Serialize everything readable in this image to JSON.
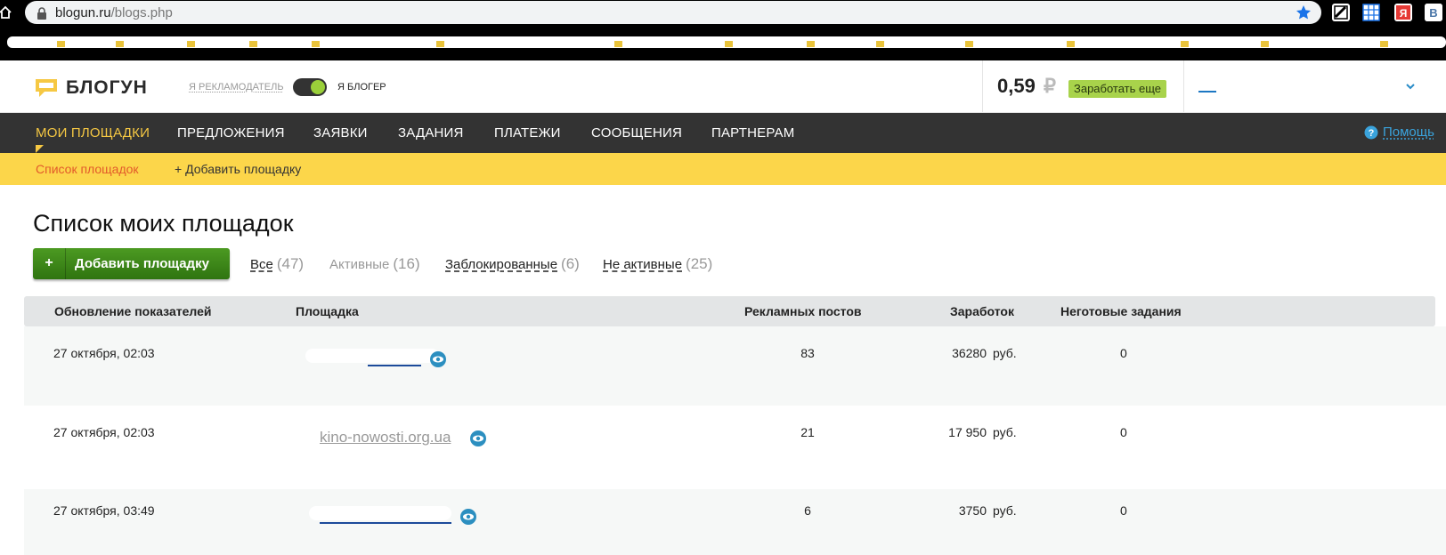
{
  "browser": {
    "url_host": "blogun.ru",
    "url_path": "/blogs.php",
    "extensions": [
      {
        "icon": "extension-icon",
        "color": "#ffffff"
      },
      {
        "icon": "grid-icon",
        "color": "#1a73e8"
      },
      {
        "icon": "yandex-icon",
        "color": "#e53935"
      },
      {
        "icon": "vk-icon",
        "color": "#4a76a8"
      }
    ],
    "vk_letter": "В"
  },
  "header": {
    "logo_text": "БЛОГУН",
    "role_advertiser": "Я РЕКЛАМОДАТЕЛЬ",
    "role_blogger": "Я БЛОГЕР",
    "balance_value": "0,59",
    "balance_currency": "₽",
    "earn_more": "Заработать еще"
  },
  "nav": {
    "items": [
      "МОИ ПЛОЩАДКИ",
      "ПРЕДЛОЖЕНИЯ",
      "ЗАЯВКИ",
      "ЗАДАНИЯ",
      "ПЛАТЕЖИ",
      "СООБЩЕНИЯ",
      "ПАРТНЕРАМ"
    ],
    "help": "Помощь"
  },
  "subnav": {
    "list": "Список площадок",
    "add": "+ Добавить площадку"
  },
  "page": {
    "title": "Список моих площадок",
    "add_button": "Добавить площадку",
    "add_button_plus": "+",
    "filters": [
      {
        "label": "Все",
        "count": "(47)"
      },
      {
        "label": "Активные",
        "count": "(16)"
      },
      {
        "label": "Заблокированные",
        "count": "(6)"
      },
      {
        "label": "Не активные",
        "count": "(25)"
      }
    ]
  },
  "table": {
    "headers": [
      "Обновление показателей",
      "Площадка",
      "Рекламных постов",
      "Заработок",
      "Неготовые задания"
    ],
    "rows": [
      {
        "updated": "27 октября, 02:03",
        "site": "",
        "posts": "83",
        "earnings": "36280",
        "currency": "руб.",
        "pending": "0"
      },
      {
        "updated": "27 октября, 02:03",
        "site": "kino-nowosti.org.ua",
        "posts": "21",
        "earnings": "17 950",
        "currency": "руб.",
        "pending": "0"
      },
      {
        "updated": "27 октября, 03:49",
        "site": "",
        "posts": "6",
        "earnings": "3750",
        "currency": "руб.",
        "pending": "0"
      }
    ]
  },
  "colors": {
    "accent_yellow": "#fcd64a",
    "nav_dark": "#333333",
    "active_nav": "#f6c843",
    "button_green": "#3a8618",
    "link_blue": "#3aa3dc",
    "subnav_active": "#e25a2a"
  }
}
